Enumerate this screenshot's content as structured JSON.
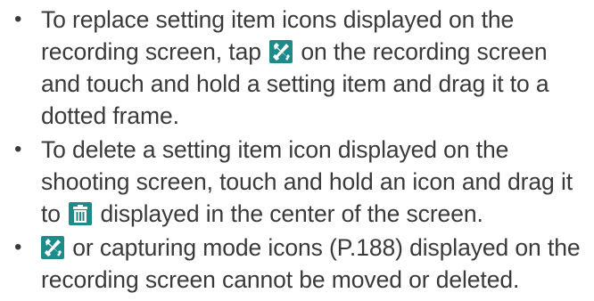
{
  "bullets": [
    {
      "parts": [
        "To replace setting item icons displayed on the recording screen, tap",
        "on the recording screen and touch and hold a setting item and drag it to a dotted frame."
      ],
      "icon": "settings-tools-icon"
    },
    {
      "parts": [
        "To delete a setting item icon displayed on the shooting screen, touch and hold an icon and drag it to",
        "displayed in the center of the screen."
      ],
      "icon": "trash-icon"
    },
    {
      "parts": [
        "",
        "or capturing mode icons (P.188) displayed on the recording screen cannot be moved or deleted."
      ],
      "icon": "settings-tools-icon"
    }
  ],
  "bullet_symbol": "•",
  "colors": {
    "text": "#3a3a3a",
    "icon_bg": "#1f8a8a",
    "icon_fg": "#ffffff"
  }
}
